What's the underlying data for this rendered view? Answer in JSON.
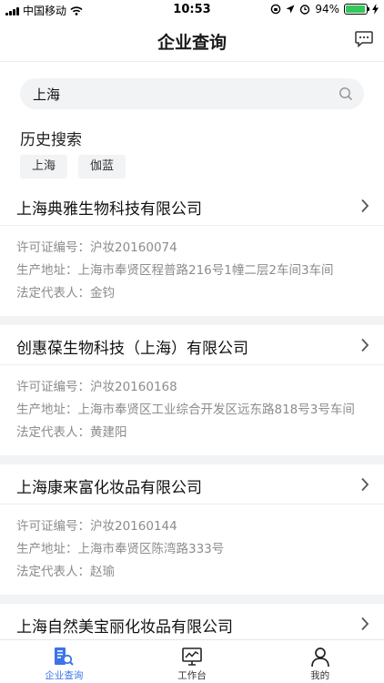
{
  "status_bar": {
    "carrier": "中国移动",
    "time": "10:53",
    "battery": "94%"
  },
  "header": {
    "title": "企业查询",
    "message_icon": "message-icon"
  },
  "search": {
    "value": "上海",
    "icon": "search-icon"
  },
  "history": {
    "title": "历史搜索",
    "tags": [
      "上海",
      "伽蓝"
    ]
  },
  "labels": {
    "license": "许可证编号：",
    "address": "生产地址：",
    "legal": "法定代表人："
  },
  "results": [
    {
      "name": "上海典雅生物科技有限公司",
      "license": "沪妆20160074",
      "address": "上海市奉贤区程普路216号1幢二层2车间3车间",
      "legal": "金钧"
    },
    {
      "name": "创惠葆生物科技（上海）有限公司",
      "license": "沪妆20160168",
      "address": "上海市奉贤区工业综合开发区远东路818号3号车间",
      "legal": "黄建阳"
    },
    {
      "name": "上海康来富化妆品有限公司",
      "license": "沪妆20160144",
      "address": "上海市奉贤区陈湾路333号",
      "legal": "赵瑜"
    },
    {
      "name": "上海自然美宝丽化妆品有限公司"
    }
  ],
  "tabbar": {
    "items": [
      {
        "label": "企业查询",
        "icon": "enterprise-search-icon",
        "active": true
      },
      {
        "label": "工作台",
        "icon": "workbench-icon",
        "active": false
      },
      {
        "label": "我的",
        "icon": "profile-icon",
        "active": false
      }
    ]
  },
  "colors": {
    "accent": "#3a74e8",
    "battery": "#34c759",
    "background_gray": "#f2f3f5"
  }
}
